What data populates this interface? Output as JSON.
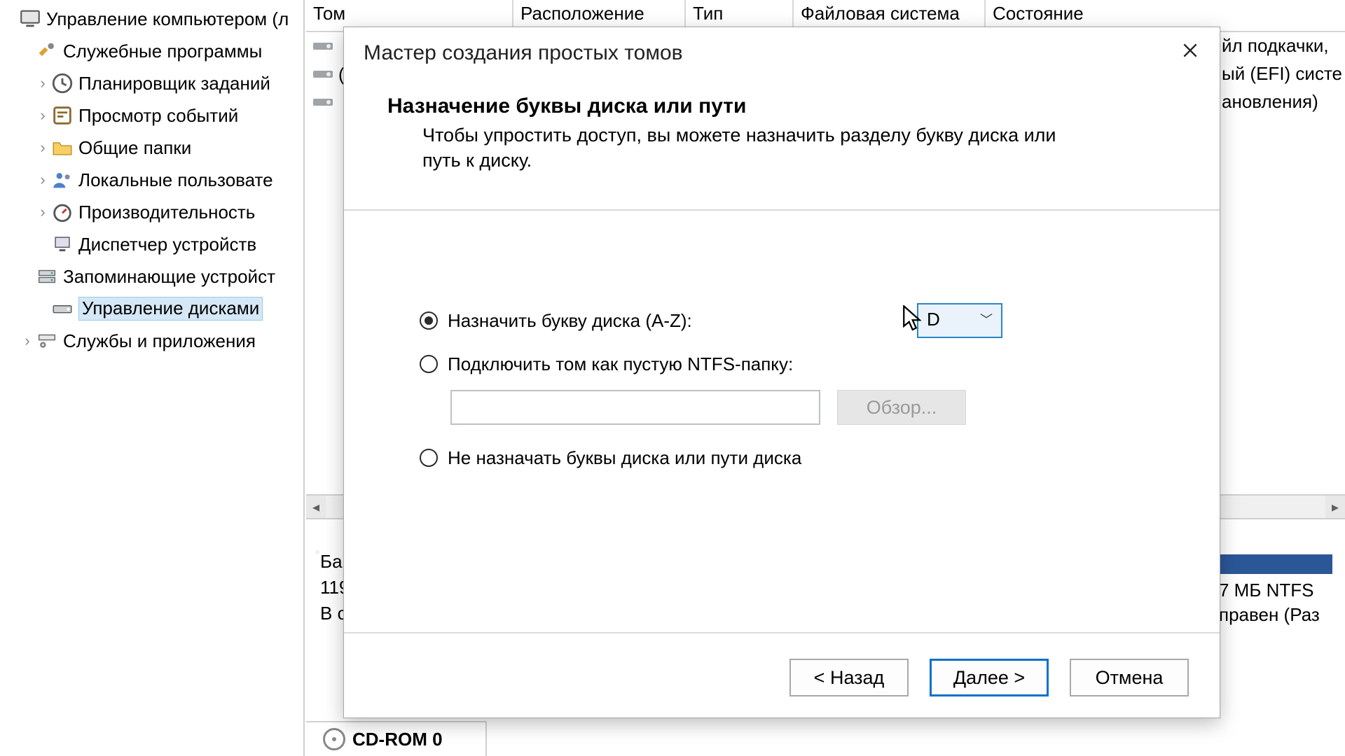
{
  "tree": {
    "root": "Управление компьютером (л",
    "svc": "Служебные программы",
    "sched": "Планировщик заданий",
    "evt": "Просмотр событий",
    "fold": "Общие папки",
    "users": "Локальные пользовате",
    "perf": "Производительность",
    "devm": "Диспетчер устройств",
    "stor": "Запоминающие устройст",
    "disk": "Управление дисками",
    "apps": "Службы и приложения"
  },
  "cols": {
    "vol": "Том",
    "loc": "Расположение",
    "type": "Тип",
    "fs": "Файловая система",
    "st": "Состояние"
  },
  "tail": {
    "l1": "йл подкачки,",
    "l2": "ый (EFI) систе",
    "l3": "ановления)"
  },
  "vol_paren": "(",
  "diskblock": {
    "l1": "Ба:",
    "l2": "119",
    "l3": "В с"
  },
  "tile": {
    "l1": "7 МБ NTFS",
    "l2": "правен (Раз"
  },
  "cd": "CD-ROM 0",
  "wizard": {
    "title": "Мастер создания простых томов",
    "heading": "Назначение буквы диска или пути",
    "desc": "Чтобы упростить доступ, вы можете назначить разделу букву диска или путь к диску.",
    "opt1": "Назначить букву диска (A-Z):",
    "letter": "D",
    "opt2": "Подключить том как пустую NTFS-папку:",
    "browse": "Обзор...",
    "opt3": "Не назначать буквы диска или пути диска",
    "back": "< Назад",
    "next": "Далее >",
    "cancel": "Отмена"
  }
}
